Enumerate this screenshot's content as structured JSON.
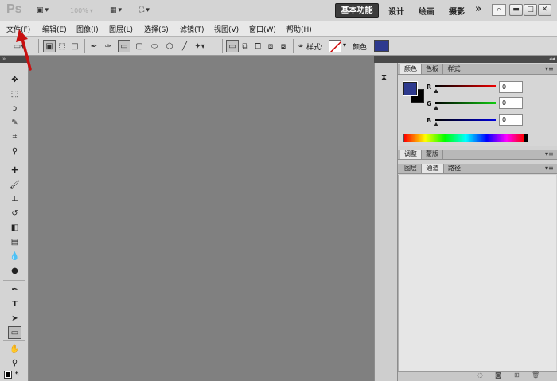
{
  "appbar": {
    "logo": "Ps",
    "zoom": "100%",
    "workspaces": [
      "基本功能",
      "设计",
      "绘画",
      "摄影"
    ],
    "active_workspace": "基本功能",
    "more": "»"
  },
  "menus": [
    "文件(F)",
    "编辑(E)",
    "图像(I)",
    "图层(L)",
    "选择(S)",
    "滤镜(T)",
    "视图(V)",
    "窗口(W)",
    "帮助(H)"
  ],
  "options": {
    "style_label": "样式:",
    "color_label": "颜色:",
    "color": "#2e3a8e"
  },
  "panels": {
    "color_tabs": [
      "颜色",
      "色板",
      "样式"
    ],
    "channels": [
      {
        "name": "R",
        "value": "0"
      },
      {
        "name": "G",
        "value": "0"
      },
      {
        "name": "B",
        "value": "0"
      }
    ],
    "fg_color": "#2e3a8e",
    "bg_color": "#000000",
    "adjust_tabs": [
      "调整",
      "蒙版"
    ],
    "layer_tabs": [
      "图层",
      "通道",
      "路径"
    ],
    "active_layer_tab": "通道"
  },
  "colors": {
    "canvas": "#808080",
    "accent": "#2e3a8e",
    "annotation_arrow": "#c81010"
  }
}
